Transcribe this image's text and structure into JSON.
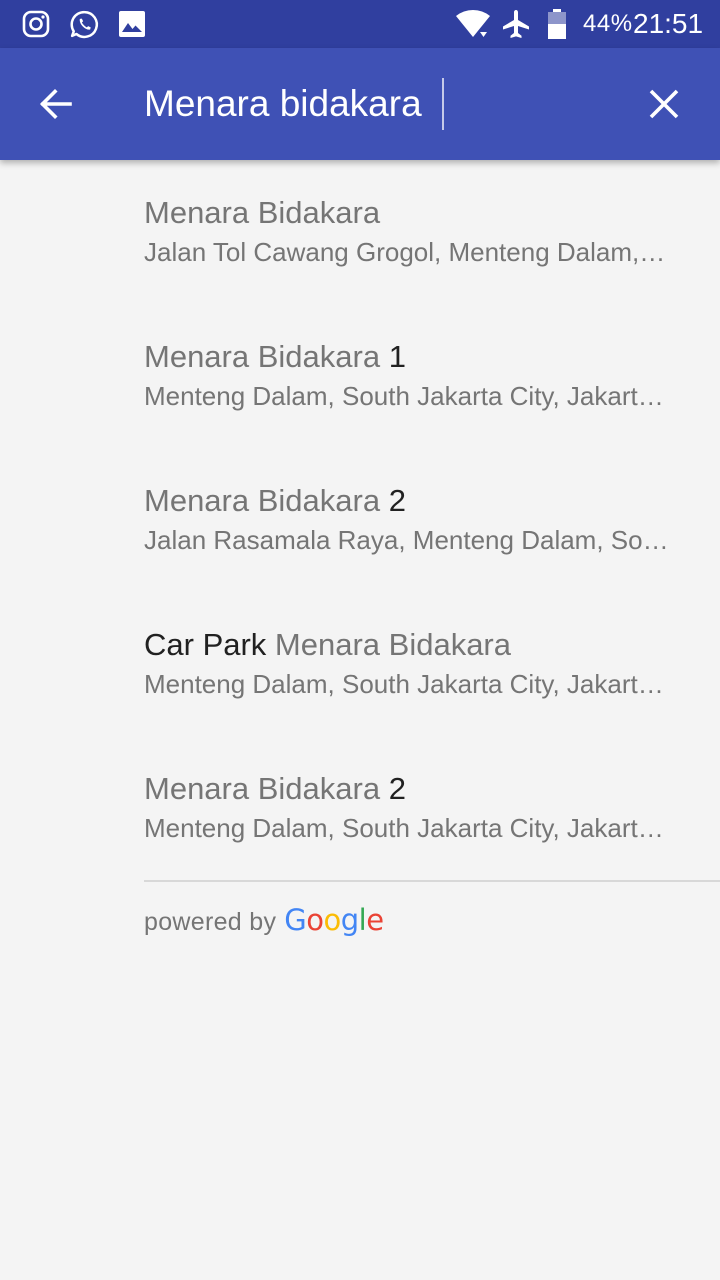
{
  "status_bar": {
    "left_icons": [
      "instagram-icon",
      "whatsapp-icon",
      "gallery-icon"
    ],
    "right_icons": [
      "wifi-icon",
      "airplane-mode-icon",
      "battery-icon"
    ],
    "battery_percent": "44%",
    "time": "21:51"
  },
  "app_bar": {
    "back_icon": "arrow-back-icon",
    "search_value": "Menara bidakara",
    "clear_icon": "close-icon"
  },
  "results": [
    {
      "title_prefix": "",
      "title_main": "Menara Bidakara",
      "title_suffix": "",
      "address": "Jalan Tol Cawang Grogol, Menteng Dalam,…"
    },
    {
      "title_prefix": "",
      "title_main": "Menara Bidakara",
      "title_suffix": " 1",
      "address": "Menteng Dalam, South Jakarta City, Jakart…"
    },
    {
      "title_prefix": "",
      "title_main": "Menara Bidakara",
      "title_suffix": " 2",
      "address": "Jalan Rasamala Raya, Menteng Dalam, So…"
    },
    {
      "title_prefix": "Car Park ",
      "title_main": "Menara Bidakara",
      "title_suffix": "",
      "address": "Menteng Dalam, South Jakarta City, Jakart…"
    },
    {
      "title_prefix": "",
      "title_main": "Menara Bidakara",
      "title_suffix": " 2",
      "address": "Menteng Dalam, South Jakarta City, Jakart…"
    }
  ],
  "footer": {
    "powered_by": "powered by",
    "google_logo": "Google"
  },
  "colors": {
    "status_bar": "#303f9f",
    "app_bar": "#3f51b5",
    "background": "#f4f4f4",
    "primary_text": "#212121",
    "secondary_text": "#757575",
    "google_blue": "#4285f4",
    "google_red": "#ea4335",
    "google_yellow": "#fbbc05",
    "google_green": "#34a853"
  }
}
